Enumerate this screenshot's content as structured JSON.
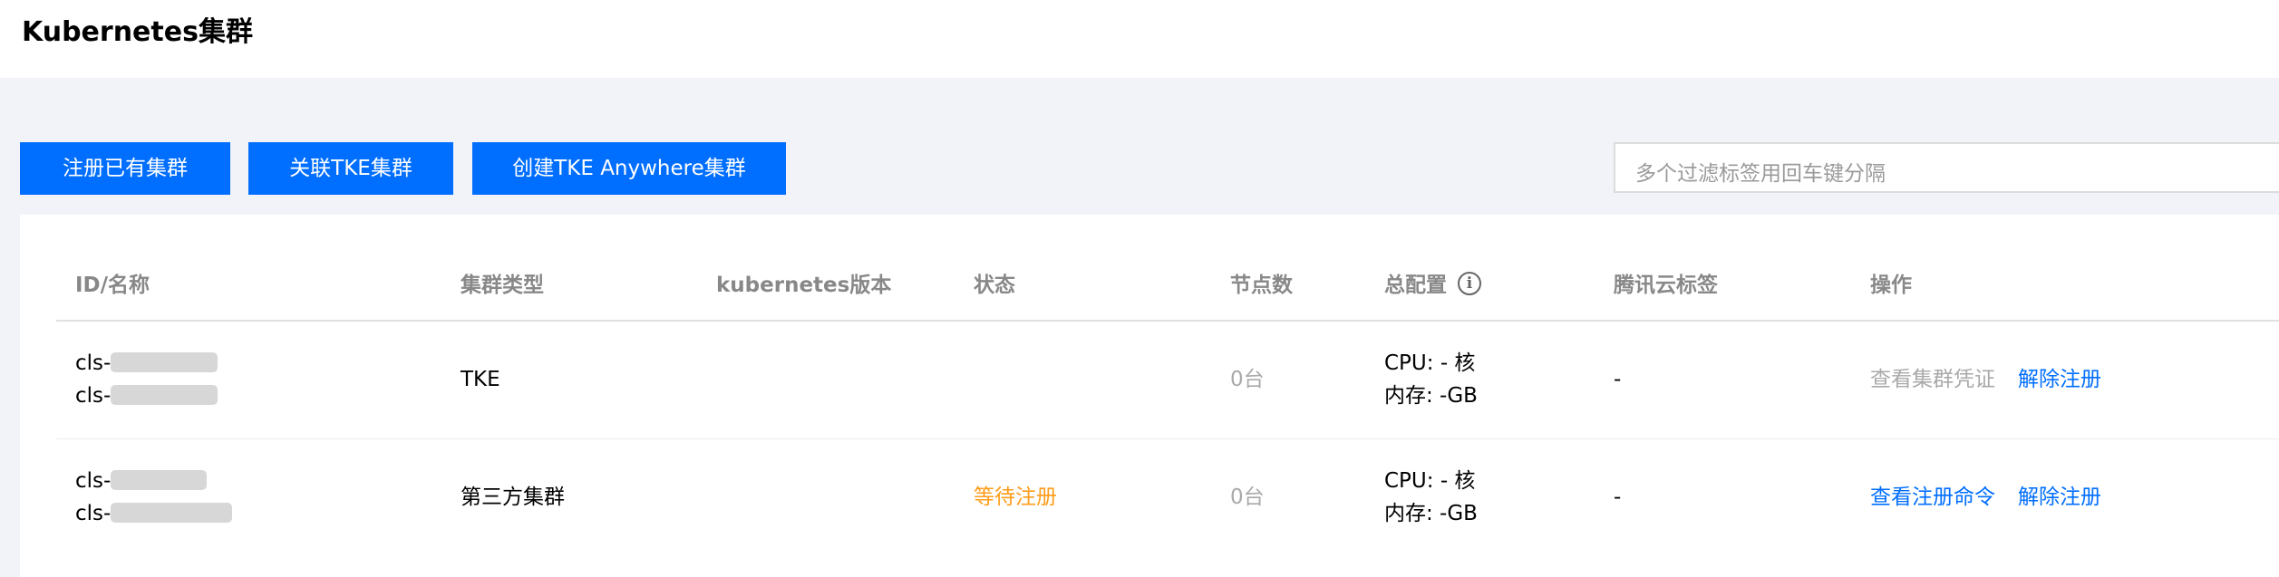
{
  "header": {
    "title": "Kubernetes集群"
  },
  "toolbar": {
    "buttons": [
      "注册已有集群",
      "关联TKE集群",
      "创建TKE Anywhere集群"
    ],
    "search_placeholder": "多个过滤标签用回车键分隔"
  },
  "table": {
    "columns": [
      "ID/名称",
      "集群类型",
      "kubernetes版本",
      "状态",
      "节点数",
      "总配置",
      "腾讯云标签",
      "操作"
    ],
    "rows": [
      {
        "id_prefix": "cls-",
        "name_prefix": "cls-",
        "type": "TKE",
        "version": "",
        "status": "",
        "nodes": "0台",
        "cpu": "CPU: - 核",
        "memory": "内存: -GB",
        "tags": "-",
        "action_primary": "查看集群凭证",
        "action_secondary": "解除注册"
      },
      {
        "id_prefix": "cls-",
        "name_prefix": "cls-",
        "type": "第三方集群",
        "version": "",
        "status": "等待注册",
        "nodes": "0台",
        "cpu": "CPU: - 核",
        "memory": "内存: -GB",
        "tags": "-",
        "action_primary": "查看注册命令",
        "action_secondary": "解除注册"
      }
    ]
  },
  "colors": {
    "primary": "#006eff",
    "warning": "#ff9c19",
    "muted": "#a9a9a9",
    "page_bg": "#f2f3f8"
  }
}
